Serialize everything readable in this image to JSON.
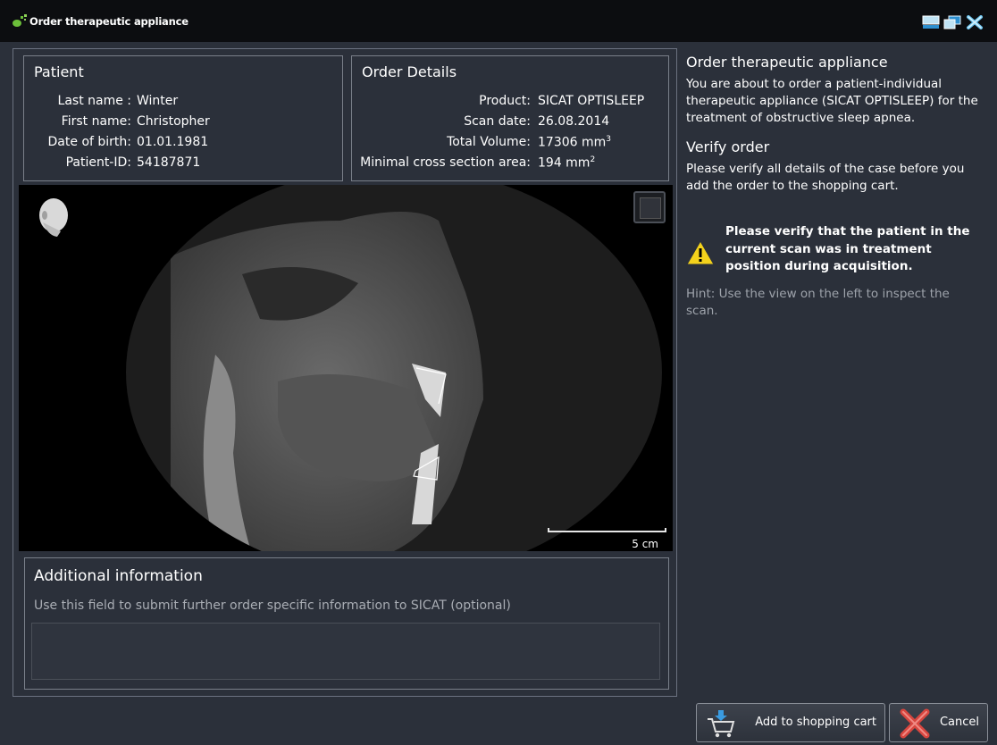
{
  "window": {
    "title": "Order therapeutic appliance"
  },
  "patient": {
    "heading": "Patient",
    "rows": [
      {
        "label": "Last name :",
        "value": "Winter"
      },
      {
        "label": "First name:",
        "value": "Christopher"
      },
      {
        "label": "Date of birth:",
        "value": "01.01.1981"
      },
      {
        "label": "Patient-ID:",
        "value": "54187871"
      }
    ]
  },
  "order": {
    "heading": "Order Details",
    "rows": [
      {
        "label": "Product:",
        "value": "SICAT OPTISLEEP"
      },
      {
        "label": "Scan date:",
        "value": "26.08.2014"
      },
      {
        "label": "Total Volume:",
        "value": "17306 mm",
        "sup": "3"
      },
      {
        "label": "Minimal cross section area:",
        "value": "194 mm",
        "sup": "2"
      }
    ]
  },
  "viewer": {
    "scale_label": "5 cm"
  },
  "additional": {
    "heading": "Additional information",
    "hint": "Use this field to submit further order specific information to SICAT (optional)",
    "value": ""
  },
  "sidebar": {
    "heading": "Order therapeutic appliance",
    "intro": "You are about to order a patient-individual therapeutic appliance (SICAT OPTISLEEP) for the treatment of obstructive sleep apnea.",
    "verify_heading": "Verify order",
    "verify_text": "Please verify all details of the case before you add the order to the shopping cart.",
    "warning": "Please verify that the patient in the current scan was in treatment position during acquisition.",
    "hint": "Hint: Use the view on the left to inspect the scan."
  },
  "buttons": {
    "add_to_cart": "Add to shopping cart",
    "cancel": "Cancel"
  },
  "colors": {
    "background": "#2b303a",
    "titlebar": "#0c0d10",
    "warning_yellow": "#f4d21c",
    "cancel_red": "#d7463f"
  }
}
